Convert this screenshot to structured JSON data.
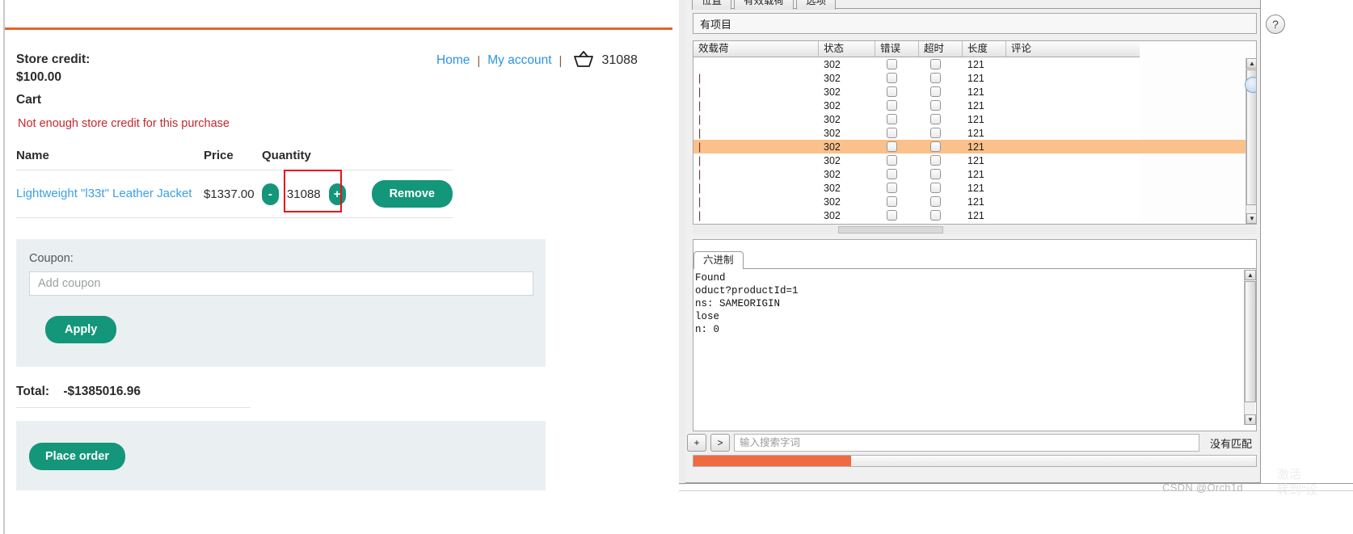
{
  "shop": {
    "nav": {
      "home": "Home",
      "my_account": "My account",
      "separator": "|",
      "basket_icon": "basket-icon",
      "basket_count": "31088"
    },
    "store_credit_label": "Store credit:",
    "store_credit_value": "$100.00",
    "cart_heading": "Cart",
    "error_message": "Not enough store credit for this purchase",
    "table": {
      "headers": [
        "Name",
        "Price",
        "Quantity"
      ],
      "rows": [
        {
          "name": "Lightweight \"l33t\" Leather Jacket",
          "price": "$1337.00",
          "qty_decrement": "-",
          "qty_value": "31088",
          "qty_increment": "+",
          "remove_label": "Remove"
        }
      ]
    },
    "coupon": {
      "label": "Coupon:",
      "placeholder": "Add coupon",
      "value": "",
      "apply_label": "Apply"
    },
    "total_label": "Total:",
    "total_value": "-$1385016.96",
    "place_order_label": "Place order",
    "accent_color": "#e8622c",
    "button_color": "#14967a",
    "link_color": "#2e93e0",
    "error_color": "#c6262e"
  },
  "burp": {
    "tabs": [
      {
        "label": "位置",
        "active": false
      },
      {
        "label": "有效载荷",
        "active": false
      },
      {
        "label": "选项",
        "active": false
      }
    ],
    "filter_text": "有项目",
    "help_label": "?",
    "table": {
      "headers": [
        "效载荷",
        "状态",
        "错误",
        "超时",
        "长度",
        "评论"
      ],
      "rows": [
        {
          "payload": "",
          "status": "302",
          "error": "",
          "timeout": "",
          "length": "121",
          "comment": "",
          "selected": false
        },
        {
          "payload": "|",
          "status": "302",
          "error": "",
          "timeout": "",
          "length": "121",
          "comment": "",
          "selected": false
        },
        {
          "payload": "|",
          "status": "302",
          "error": "",
          "timeout": "",
          "length": "121",
          "comment": "",
          "selected": false
        },
        {
          "payload": "|",
          "status": "302",
          "error": "",
          "timeout": "",
          "length": "121",
          "comment": "",
          "selected": false
        },
        {
          "payload": "|",
          "status": "302",
          "error": "",
          "timeout": "",
          "length": "121",
          "comment": "",
          "selected": false
        },
        {
          "payload": "|",
          "status": "302",
          "error": "",
          "timeout": "",
          "length": "121",
          "comment": "",
          "selected": false
        },
        {
          "payload": "|",
          "status": "302",
          "error": "",
          "timeout": "",
          "length": "121",
          "comment": "",
          "selected": true
        },
        {
          "payload": "|",
          "status": "302",
          "error": "",
          "timeout": "",
          "length": "121",
          "comment": "",
          "selected": false
        },
        {
          "payload": "|",
          "status": "302",
          "error": "",
          "timeout": "",
          "length": "121",
          "comment": "",
          "selected": false
        },
        {
          "payload": "|",
          "status": "302",
          "error": "",
          "timeout": "",
          "length": "121",
          "comment": "",
          "selected": false
        },
        {
          "payload": "|",
          "status": "302",
          "error": "",
          "timeout": "",
          "length": "121",
          "comment": "",
          "selected": false
        },
        {
          "payload": "|",
          "status": "302",
          "error": "",
          "timeout": "",
          "length": "121",
          "comment": "",
          "selected": false
        }
      ]
    },
    "response": {
      "tabs": [
        {
          "label": "六进制",
          "active": true
        }
      ],
      "body": "Found\noduct?productId=1\nns: SAMEORIGIN\nlose\nn: 0"
    },
    "search": {
      "prev_label": "+",
      "next_label": ">",
      "placeholder": "输入搜索字词",
      "value": "",
      "no_match": "没有匹配"
    },
    "progress": {
      "percent": 28,
      "color": "#ef6a40"
    },
    "selection_color": "#fbc18a"
  },
  "watermark": {
    "text": "CSDN @Orch1d",
    "cn_text": "激活\n转到\"设"
  }
}
